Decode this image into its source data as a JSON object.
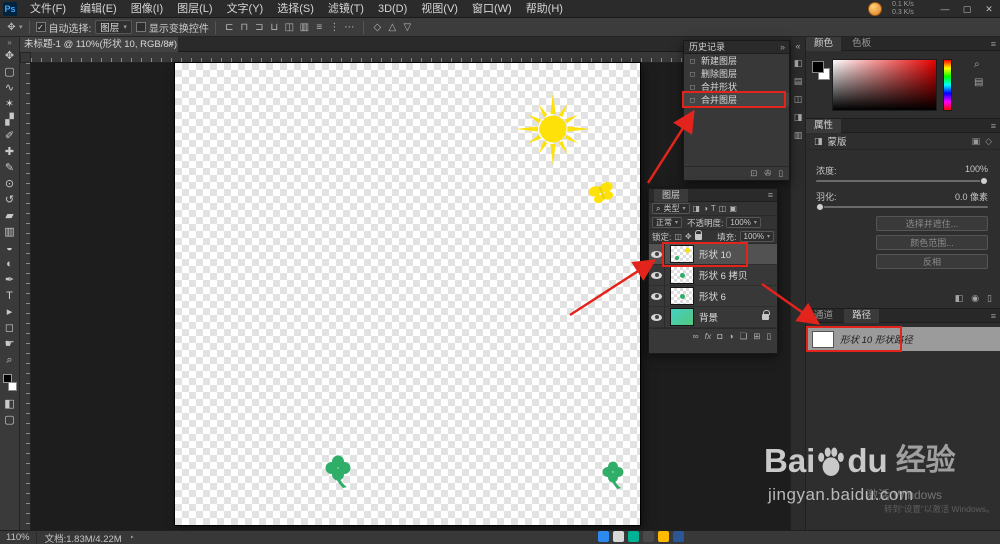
{
  "colors": {
    "accent_red": "#e2241d",
    "sun_yellow": "#ffe10a",
    "clover_green": "#2fae68"
  },
  "glyphs": {
    "chevron_down": "▾",
    "double_chevron": "»",
    "menu_lines": "≡",
    "check": "✓",
    "arrow_right": "‣",
    "search": "⌕"
  },
  "titlebar": {
    "logo": "Ps",
    "net_up": "0.1 K/s",
    "net_down": "0.3 K/s",
    "minimize": "—",
    "maximize": "▢",
    "close": "✕"
  },
  "menubar": {
    "items": [
      "文件(F)",
      "编辑(E)",
      "图像(I)",
      "图层(L)",
      "文字(Y)",
      "选择(S)",
      "滤镜(T)",
      "3D(D)",
      "视图(V)",
      "窗口(W)",
      "帮助(H)"
    ]
  },
  "optionsbar": {
    "tool_glyph": "✥",
    "auto_select_label": "自动选择:",
    "auto_select_value": "图层",
    "show_transform_label": "显示变换控件",
    "icons": [
      "⊏",
      "⊓",
      "⊐",
      "⊔",
      "◫",
      "▥",
      "≡",
      "⋮",
      "⋯",
      "◇",
      "△",
      "▽"
    ]
  },
  "document": {
    "tab_title": "未标题-1 @ 110%(形状 10, RGB/8#)",
    "tab_close": "✕"
  },
  "toolbar": {
    "tools": [
      {
        "name": "move",
        "glyph": "✥"
      },
      {
        "name": "marquee",
        "glyph": "▢"
      },
      {
        "name": "lasso",
        "glyph": "∿"
      },
      {
        "name": "quick-select",
        "glyph": "✶"
      },
      {
        "name": "crop",
        "glyph": "▞"
      },
      {
        "name": "eyedropper",
        "glyph": "✐"
      },
      {
        "name": "healing",
        "glyph": "✚"
      },
      {
        "name": "brush",
        "glyph": "✎"
      },
      {
        "name": "clone-stamp",
        "glyph": "⊙"
      },
      {
        "name": "history-brush",
        "glyph": "↺"
      },
      {
        "name": "eraser",
        "glyph": "▰"
      },
      {
        "name": "gradient",
        "glyph": "▥"
      },
      {
        "name": "blur",
        "glyph": "◒"
      },
      {
        "name": "dodge",
        "glyph": "◐"
      },
      {
        "name": "pen",
        "glyph": "✒"
      },
      {
        "name": "type",
        "glyph": "T"
      },
      {
        "name": "path-select",
        "glyph": "▸"
      },
      {
        "name": "shape",
        "glyph": "◻"
      },
      {
        "name": "hand",
        "glyph": "☛"
      },
      {
        "name": "zoom",
        "glyph": "⌕"
      }
    ]
  },
  "history_panel": {
    "title": "历史记录",
    "entries": [
      {
        "label": "新建图层"
      },
      {
        "label": "删除图层"
      },
      {
        "label": "合并形状"
      },
      {
        "label": "合并图层"
      }
    ],
    "footer_icons": [
      "⊡",
      "✇",
      "▯"
    ]
  },
  "layers_panel": {
    "tab": "图层",
    "search_label": "类型",
    "filter_icons": [
      "◨",
      "◑",
      "T",
      "◫",
      "▣"
    ],
    "blend_mode": "正常",
    "opacity_label": "不透明度:",
    "opacity_value": "100%",
    "lock_label": "锁定:",
    "fill_label": "填充:",
    "fill_value": "100%",
    "layers": [
      {
        "name": "形状 10"
      },
      {
        "name": "形状 6 拷贝"
      },
      {
        "name": "形状 6"
      },
      {
        "name": "背景"
      }
    ],
    "footer_icons": [
      "∞",
      "fx",
      "◘",
      "◑",
      "❏",
      "⊞",
      "▯"
    ]
  },
  "color_panel": {
    "tab_color": "颜色",
    "tab_swatches": "色板",
    "strip_icons": [
      "⌕",
      "▤"
    ]
  },
  "properties_panel": {
    "tab": "属性",
    "section_label": "蒙版",
    "density_label": "浓度:",
    "density_value": "100%",
    "feather_label": "羽化:",
    "feather_value": "0.0 像素",
    "buttons": [
      "选择并遮住...",
      "颜色范围...",
      "反相"
    ],
    "footer_icons": [
      "◧",
      "◉",
      "▯"
    ]
  },
  "paths_panel": {
    "tab_channels": "通道",
    "tab_paths": "路径",
    "path_item": "形状 10 形状路径"
  },
  "statusbar": {
    "zoom": "110%",
    "doc_info": "文档:1.83M/4.22M"
  },
  "watermark": {
    "brand_left": "Bai",
    "brand_right": "du",
    "brand_suffix": "经验",
    "url": "jingyan.baidu.com",
    "activate_line1": "激活 Windows",
    "activate_line2": "转到“设置”以激活 Windows。"
  },
  "dock_strip_icons": [
    "«",
    "◧",
    "▤",
    "◫",
    "◨",
    "▥"
  ]
}
